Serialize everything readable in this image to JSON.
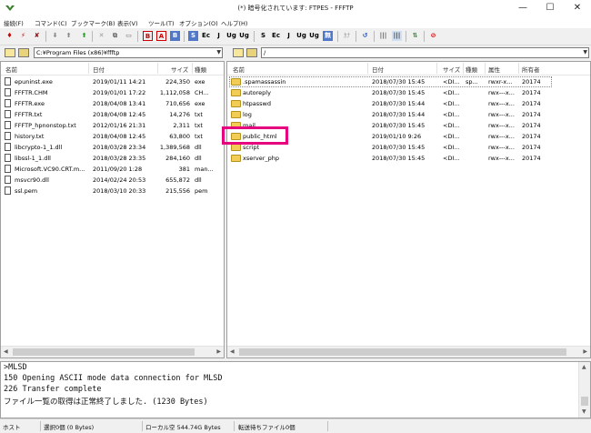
{
  "window": {
    "title": "(*) 暗号化されています: FTPES - FFFTP",
    "controls": [
      "—",
      "☐",
      "✕"
    ]
  },
  "menu": [
    "接続(F)",
    "コマンド(C)",
    "ブックマーク(B)",
    "表示(V)",
    "ツール(T)",
    "オプション(O)",
    "ヘルプ(H)"
  ],
  "toolbar": {
    "buttons": [
      "♦",
      "⚡",
      "✘",
      "⬇",
      "⬆",
      "⬆",
      "✕",
      "⧉",
      "▭",
      "B",
      "A",
      "B",
      "S",
      "Ec",
      "J",
      "Ug",
      "Ug",
      "S",
      "Ec",
      "J",
      "Ug",
      "Ug",
      "無",
      "ｶﾅ",
      "↺",
      "|||",
      "|||",
      "⇅",
      "⊘"
    ]
  },
  "colors": {
    "highlight": "#e6007e",
    "folder": "#f2cc55"
  },
  "local": {
    "path": "C:¥Program Files (x86)¥ffftp",
    "headers": {
      "name": "名前",
      "date": "日付",
      "size": "サイズ",
      "type": "種類"
    },
    "files": [
      {
        "name": "epuninst.exe",
        "date": "2019/01/11 14:21",
        "size": "224,350",
        "type": "exe"
      },
      {
        "name": "FFFTR.CHM",
        "date": "2019/01/01 17:22",
        "size": "1,112,058",
        "type": "CH..."
      },
      {
        "name": "FFFTR.exe",
        "date": "2018/04/08 13:41",
        "size": "710,656",
        "type": "exe"
      },
      {
        "name": "FFFTR.txt",
        "date": "2018/04/08 12:45",
        "size": "14,276",
        "type": "txt"
      },
      {
        "name": "FFFTP_hpnonstop.txt",
        "date": "2012/01/16 21:31",
        "size": "2,311",
        "type": "txt"
      },
      {
        "name": "history.txt",
        "date": "2018/04/08 12:45",
        "size": "63,800",
        "type": "txt"
      },
      {
        "name": "libcrypto-1_1.dll",
        "date": "2018/03/28 23:34",
        "size": "1,389,568",
        "type": "dll"
      },
      {
        "name": "libssl-1_1.dll",
        "date": "2018/03/28 23:35",
        "size": "284,160",
        "type": "dll"
      },
      {
        "name": "Microsoft.VC90.CRT.m...",
        "date": "2011/09/20 1:28",
        "size": "381",
        "type": "man..."
      },
      {
        "name": "msvcr90.dll",
        "date": "2014/02/24 20:53",
        "size": "655,872",
        "type": "dll"
      },
      {
        "name": "ssl.pem",
        "date": "2018/03/10 20:33",
        "size": "215,556",
        "type": "pem"
      }
    ]
  },
  "remote": {
    "path": "/",
    "headers": {
      "name": "名前",
      "date": "日付",
      "size": "サイズ",
      "type": "種類",
      "attr": "属性",
      "owner": "所有者"
    },
    "files": [
      {
        "name": ".spamassassin",
        "date": "2018/07/30 15:45",
        "size": "<DI...",
        "type": "sp...",
        "attr": "rwxr-x...",
        "owner": "20174"
      },
      {
        "name": "autoreply",
        "date": "2018/07/30 15:45",
        "size": "<DI...",
        "type": "",
        "attr": "rwx---x...",
        "owner": "20174"
      },
      {
        "name": "htpasswd",
        "date": "2018/07/30 15:44",
        "size": "<DI...",
        "type": "",
        "attr": "rwx---x...",
        "owner": "20174"
      },
      {
        "name": "log",
        "date": "2018/07/30 15:44",
        "size": "<DI...",
        "type": "",
        "attr": "rwx---x...",
        "owner": "20174"
      },
      {
        "name": "mail",
        "date": "2018/07/30 15:45",
        "size": "<DI...",
        "type": "",
        "attr": "rwx---x...",
        "owner": "20174"
      },
      {
        "name": "public_html",
        "date": "2019/01/10 9:26",
        "size": "<DI...",
        "type": "",
        "attr": "rwx---x...",
        "owner": "20174"
      },
      {
        "name": "script",
        "date": "2018/07/30 15:45",
        "size": "<DI...",
        "type": "",
        "attr": "rwx---x...",
        "owner": "20174"
      },
      {
        "name": "xserver_php",
        "date": "2018/07/30 15:45",
        "size": "<DI...",
        "type": "",
        "attr": "rwx---x...",
        "owner": "20174"
      }
    ]
  },
  "log": [
    ">MLSD",
    "150 Opening ASCII mode data connection for MLSD",
    "226 Transfer complete",
    "ファイル一覧の取得は正常終了しました. (1230 Bytes)"
  ],
  "status": {
    "host": "ホスト",
    "selected": "選択0個 (0 Bytes)",
    "local_free": "ローカル空 544.74G Bytes",
    "queue": "転送待ちファイル0個"
  }
}
